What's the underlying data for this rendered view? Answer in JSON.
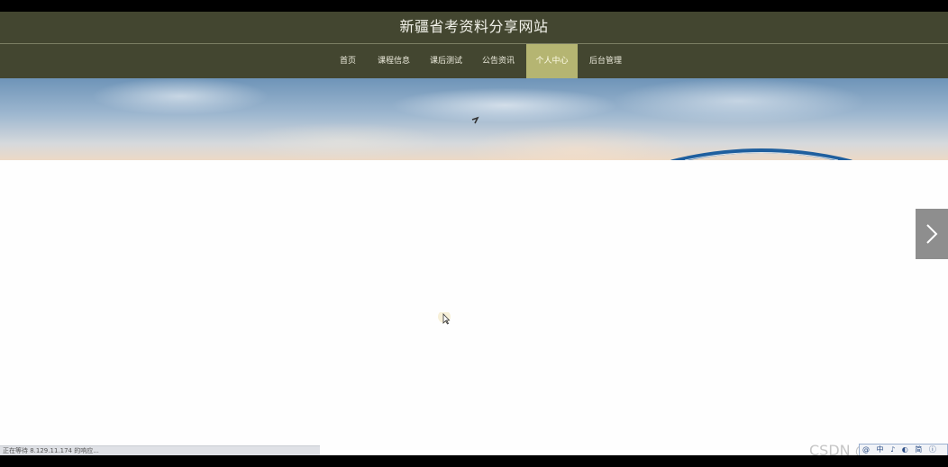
{
  "header": {
    "site_title": "新疆省考资料分享网站"
  },
  "nav": {
    "items": [
      {
        "label": "首页",
        "active": false
      },
      {
        "label": "课程信息",
        "active": false
      },
      {
        "label": "课后测试",
        "active": false
      },
      {
        "label": "公告资讯",
        "active": false
      },
      {
        "label": "个人中心",
        "active": true
      },
      {
        "label": "后台管理",
        "active": false
      }
    ]
  },
  "browser": {
    "status_text": "正在等待 8.129.11.174 的响应..."
  },
  "overlay": {
    "watermark": "CSDN @ck0021",
    "ime_items": [
      "@",
      "中",
      "♪",
      "◐",
      "简",
      "ⓘ"
    ]
  },
  "colors": {
    "header_bg": "#434630",
    "nav_active_bg": "#b5b572",
    "page_bg": "#fefefe"
  },
  "icons": {
    "carousel_next": "chevron-right-icon",
    "cursor": "mouse-pointer-icon"
  }
}
